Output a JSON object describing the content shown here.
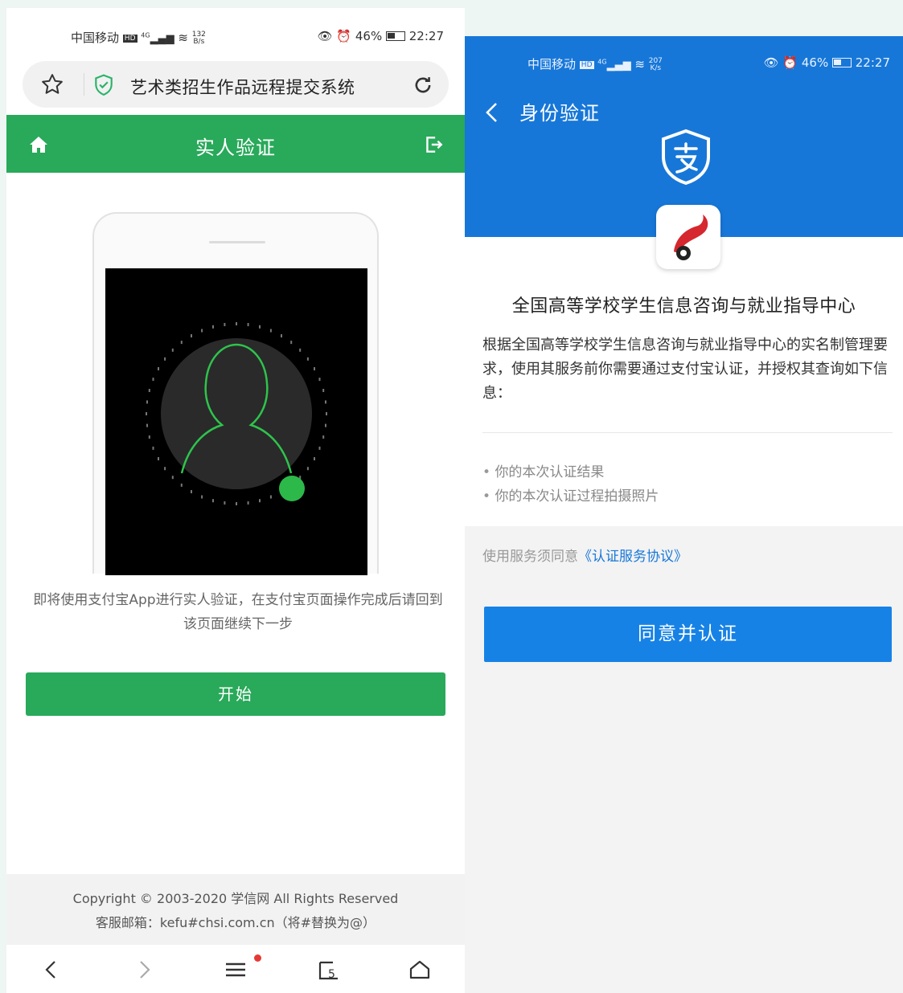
{
  "left": {
    "status_bar": {
      "carrier": "中国移动",
      "network": "4G",
      "speed_value": "132",
      "speed_unit": "B/s",
      "battery": "46%",
      "time": "22:27"
    },
    "url_bar": {
      "title": "艺术类招生作品远程提交系统"
    },
    "header": {
      "title": "实人验证"
    },
    "hint": "即将使用支付宝App进行实人验证，在支付宝页面操作完成后请回到该页面继续下一步",
    "start_button": "开始",
    "footer": {
      "copyright": "Copyright © 2003-2020 学信网 All Rights Reserved",
      "email": "客服邮箱：kefu#chsi.com.cn（将#替换为@）"
    },
    "bottom_nav": {
      "tabs_count": "5"
    }
  },
  "right": {
    "status_bar": {
      "carrier": "中国移动",
      "network": "4G",
      "speed_value": "207",
      "speed_unit": "K/s",
      "battery": "46%",
      "time": "22:27"
    },
    "header": {
      "title": "身份验证"
    },
    "org_name": "全国高等学校学生信息咨询与就业指导中心",
    "description": "根据全国高等学校学生信息咨询与就业指导中心的实名制管理要求，使用其服务前你需要通过支付宝认证，并授权其查询如下信息：",
    "info_items": [
      "你的本次认证结果",
      "你的本次认证过程拍摄照片"
    ],
    "agreement_prefix": "使用服务须同意",
    "agreement_link": "《认证服务协议》",
    "agree_button": "同意并认证"
  },
  "colors": {
    "green": "#29a95a",
    "blue": "#1777d8",
    "button_blue": "#1782e6",
    "badge_red": "#e53935"
  }
}
